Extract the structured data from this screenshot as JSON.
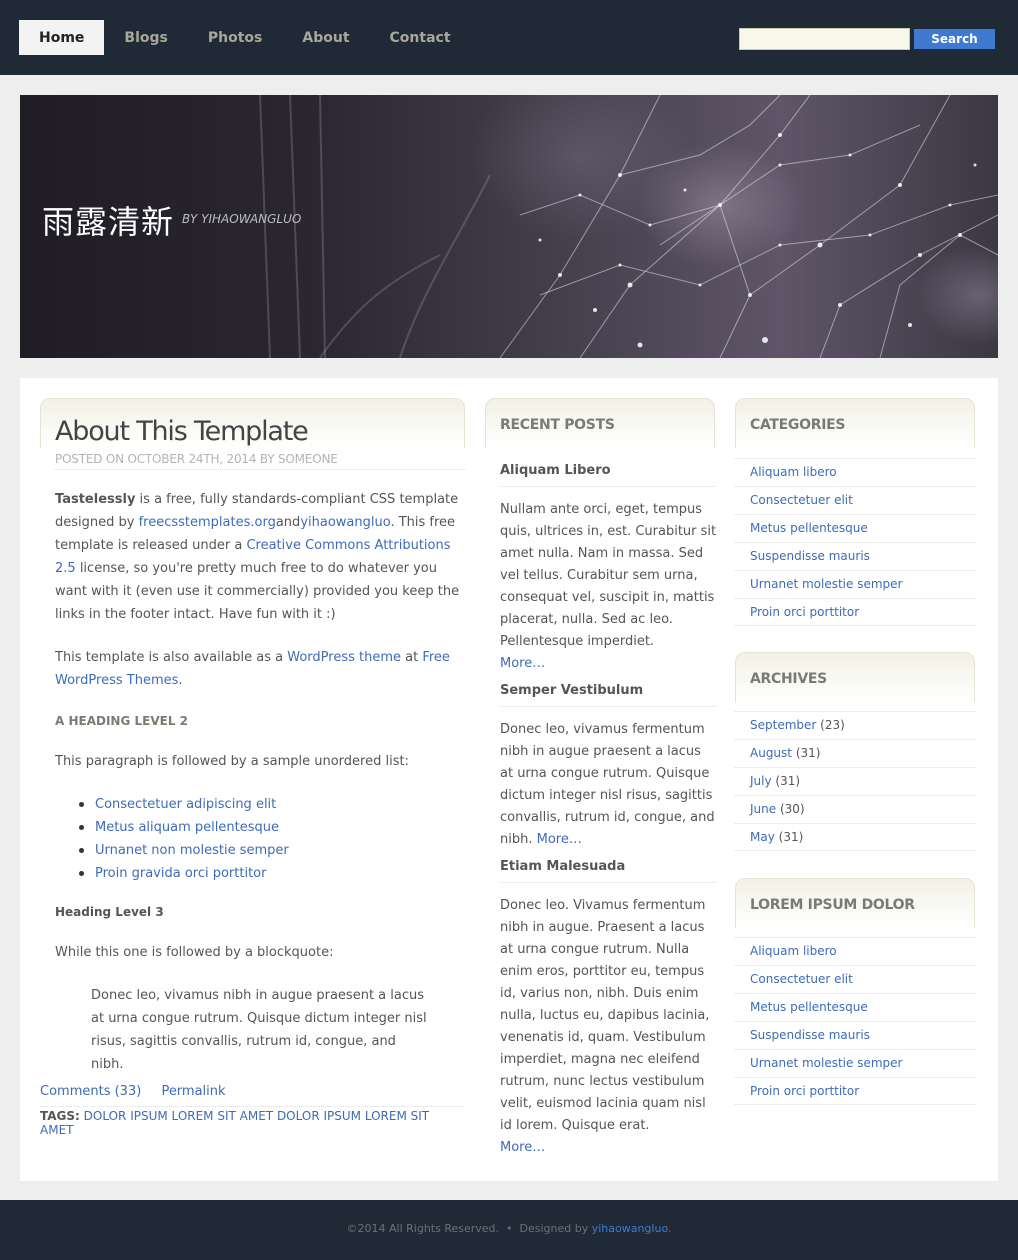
{
  "nav": {
    "items": [
      {
        "label": "Home",
        "active": true
      },
      {
        "label": "Blogs",
        "active": false
      },
      {
        "label": "Photos",
        "active": false
      },
      {
        "label": "About",
        "active": false
      },
      {
        "label": "Contact",
        "active": false
      }
    ]
  },
  "search": {
    "value": "",
    "button_label": "Search"
  },
  "banner": {
    "title": "雨露清新",
    "byline": "BY YIHAOWANGLUO"
  },
  "post": {
    "title": "About This Template",
    "meta": "POSTED ON OCTOBER 24TH, 2014 BY SOMEONE",
    "intro": {
      "strong": "Tastelessly",
      "text1": " is a free, fully standards-compliant CSS template designed by ",
      "link1": "freecsstemplates.org",
      "text2": "and",
      "link2": "yihaowangluo",
      "text3": ". This free template is released under a ",
      "link3": "Creative Commons Attributions 2.5",
      "text4": " license, so you're pretty much free to do whatever you want with it (even use it commercially) provided you keep the links in the footer intact. Have fun with it :)"
    },
    "para2": {
      "text1": "This template is also available as a ",
      "link1": "WordPress theme",
      "text2": " at ",
      "link2": "Free WordPress Themes",
      "text3": "."
    },
    "heading2": "A HEADING LEVEL 2",
    "list_intro": "This paragraph is followed by a sample unordered list:",
    "list": [
      "Consectetuer adipiscing elit",
      "Metus aliquam pellentesque",
      "Urnanet non molestie semper",
      "Proin gravida orci porttitor"
    ],
    "heading3": "Heading Level 3",
    "quote_intro": "While this one is followed by a blockquote:",
    "blockquote": "Donec leo, vivamus nibh in augue praesent a lacus at urna congue rutrum. Quisque dictum integer nisl risus, sagittis convallis, rutrum id, congue, and nibh.",
    "comments": "Comments (33)",
    "permalink": "Permalink",
    "tags_label": "TAGS:",
    "tags": "DOLOR IPSUM LOREM SIT AMET DOLOR IPSUM LOREM SIT AMET"
  },
  "recent_posts": {
    "heading": "RECENT POSTS",
    "items": [
      {
        "title": "Aliquam Libero",
        "text": "Nullam ante orci, eget, tempus quis, ultrices in, est. Curabitur sit amet nulla. Nam in massa. Sed vel tellus. Curabitur sem urna, consequat vel, suscipit in, mattis placerat, nulla. Sed ac leo. Pellentesque imperdiet.",
        "more": "More…"
      },
      {
        "title": "Semper Vestibulum",
        "text": "Donec leo, vivamus fermentum nibh in augue praesent a lacus at urna congue rutrum. Quisque dictum integer nisl risus, sagittis convallis, rutrum id, congue, and nibh.",
        "more": "More…"
      },
      {
        "title": "Etiam Malesuada",
        "text": "Donec leo. Vivamus fermentum nibh in augue. Praesent a lacus at urna congue rutrum. Nulla enim eros, porttitor eu, tempus id, varius non, nibh. Duis enim nulla, luctus eu, dapibus lacinia, venenatis id, quam. Vestibulum imperdiet, magna nec eleifend rutrum, nunc lectus vestibulum velit, euismod lacinia quam nisl id lorem. Quisque erat.",
        "more": "More…"
      }
    ]
  },
  "categories": {
    "heading": "CATEGORIES",
    "items": [
      "Aliquam libero",
      "Consectetuer elit",
      "Metus pellentesque",
      "Suspendisse mauris",
      "Urnanet molestie semper",
      "Proin orci porttitor"
    ]
  },
  "archives": {
    "heading": "ARCHIVES",
    "items": [
      {
        "month": "September",
        "count": "(23)"
      },
      {
        "month": "August",
        "count": "(31)"
      },
      {
        "month": "July",
        "count": "(31)"
      },
      {
        "month": "June",
        "count": "(30)"
      },
      {
        "month": "May",
        "count": "(31)"
      }
    ]
  },
  "lorem": {
    "heading": "LOREM IPSUM DOLOR",
    "items": [
      "Aliquam libero",
      "Consectetuer elit",
      "Metus pellentesque",
      "Suspendisse mauris",
      "Urnanet molestie semper",
      "Proin orci porttitor"
    ]
  },
  "footer": {
    "text": "©2014 All Rights Reserved.  •  Designed by ",
    "link": "yihaowangluo",
    "end": "."
  },
  "colors": {
    "topbar": "#1f2a36",
    "accent": "#3f7ad0",
    "link": "#3d6bb8",
    "heading": "#7b7b72"
  }
}
